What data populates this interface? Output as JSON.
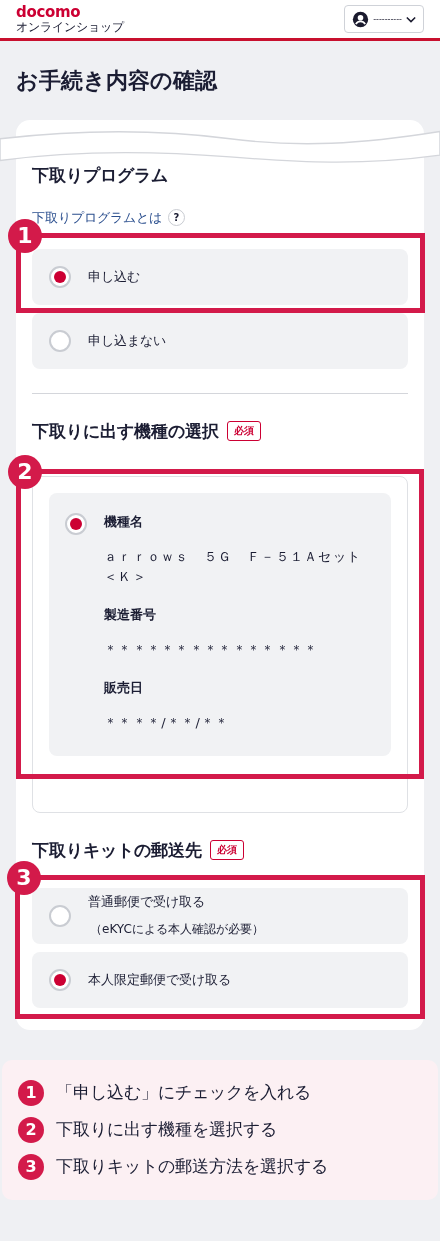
{
  "header": {
    "logo": "docomo",
    "logo_sub": "オンラインショップ",
    "account": "----------"
  },
  "page_title": "お手続き内容の確認",
  "trade_in_program": {
    "title": "下取りプログラム",
    "help_link": "下取りプログラムとは",
    "help_icon": "?",
    "annotation": "1",
    "options": [
      {
        "label": "申し込む",
        "selected": true
      },
      {
        "label": "申し込まない",
        "selected": false
      }
    ]
  },
  "device_selection": {
    "title": "下取りに出す機種の選択",
    "required_badge": "必須",
    "annotation": "2",
    "devices": [
      {
        "selected": true,
        "fields": [
          {
            "label": "機種名",
            "value": "ａｒｒｏｗｓ　５Ｇ　Ｆ－５１Ａセット＜Ｋ＞"
          },
          {
            "label": "製造番号",
            "value": "＊＊＊＊＊＊＊＊＊＊＊＊＊＊＊"
          },
          {
            "label": "販売日",
            "value": "＊＊＊＊/＊＊/＊＊"
          }
        ]
      }
    ]
  },
  "kit_delivery": {
    "title": "下取りキットの郵送先",
    "required_badge": "必須",
    "annotation": "3",
    "options": [
      {
        "label": "普通郵便で受け取る",
        "note": "（eKYCによる本人確認が必要）",
        "selected": false
      },
      {
        "label": "本人限定郵便で受け取る",
        "selected": true
      }
    ]
  },
  "legend": [
    {
      "number": "1",
      "text": "「申し込む」にチェックを入れる"
    },
    {
      "number": "2",
      "text": "下取りに出す機種を選択する"
    },
    {
      "number": "3",
      "text": "下取りキットの郵送方法を選択する"
    }
  ]
}
